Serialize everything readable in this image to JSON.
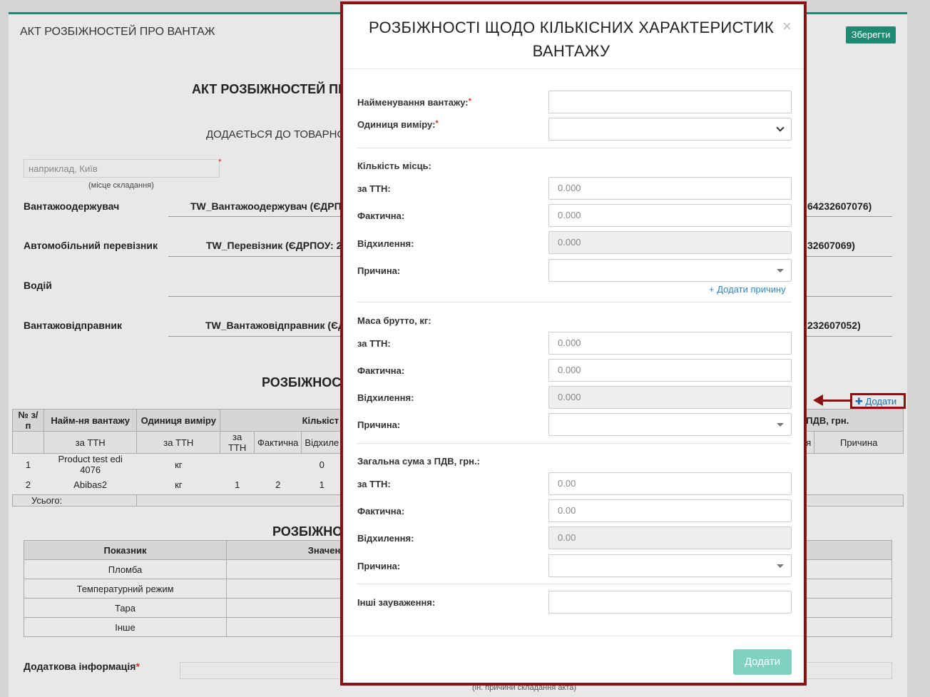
{
  "page": {
    "title": "АКТ РОЗБІЖНОСТЕЙ ПРО ВАНТАЖ",
    "save_label": "Зберегти",
    "doc_title": "АКТ РОЗБІЖНОСТЕЙ ПР",
    "doc_subtitle": "ДОДАЄТЬСЯ ДО ТОВАРНО",
    "place_placeholder": "наприклад, Київ",
    "place_caption": "(місце складання)",
    "parties": [
      {
        "label": "Вантажоодержувач",
        "value": "TW_Вантажоодержувач (ЄДРП",
        "tail": "64232607076)"
      },
      {
        "label": "Автомобільний перевізник",
        "value": "TW_Перевізник (ЄДРПОУ: 22",
        "tail": "32607069)"
      },
      {
        "label": "Водій",
        "value": "",
        "tail": ""
      },
      {
        "label": "Вантажовідправник",
        "value": "TW_Вантажовідправник (ЄД",
        "tail": "232607052)"
      }
    ],
    "section1_title": "РОЗБІЖНОСТ",
    "add_label": "Додати",
    "table1": {
      "headers": [
        "№ з/п",
        "Найм-ня вантажу",
        "Одиниця виміру",
        "Кількіст",
        "ПДВ, грн."
      ],
      "subheaders": [
        "за ТТН",
        "за ТТН",
        "за ТТН",
        "Фактична",
        "Відхиле",
        "я",
        "Причина"
      ],
      "rows": [
        [
          "1",
          "Product test edi 4076",
          "кг",
          "",
          "",
          "0"
        ],
        [
          "2",
          "Abibas2",
          "кг",
          "1",
          "2",
          "1"
        ]
      ],
      "total_label": "Усього:"
    },
    "section2_title": "РОЗБІЖНО",
    "table2": {
      "headers": [
        "Показник",
        "Значення в ТТН"
      ],
      "rows": [
        "Пломба",
        "Температурний режим",
        "Тара",
        "Інше"
      ]
    },
    "extra_label": "Додаткова інформація",
    "extra_caption": "(ін. причини складання акта)"
  },
  "modal": {
    "title": "РОЗБІЖНОСТІ ЩОДО КІЛЬКІСНИХ ХАРАКТЕРИСТИК ВАНТАЖУ",
    "close": "×",
    "name_label": "Найменування вантажу:",
    "unit_label": "Одиниця виміру:",
    "req_mark": "*",
    "places_title": "Кількість місць:",
    "mass_title": "Маса брутто, кг:",
    "sum_title": "Загальна сума з ПДВ, грн.:",
    "ttn_label": "за ТТН:",
    "actual_label": "Фактична:",
    "deviation_label": "Відхилення:",
    "reason_label": "Причина:",
    "add_reason": "+ Додати причину",
    "places_ttn": "0.000",
    "places_actual": "0.000",
    "places_dev": "0.000",
    "mass_ttn": "0.000",
    "mass_actual": "0.000",
    "mass_dev": "0.000",
    "sum_ttn": "0.00",
    "sum_actual": "0.00",
    "sum_dev": "0.00",
    "other_label": "Інші зауваження:",
    "submit": "Додати"
  }
}
